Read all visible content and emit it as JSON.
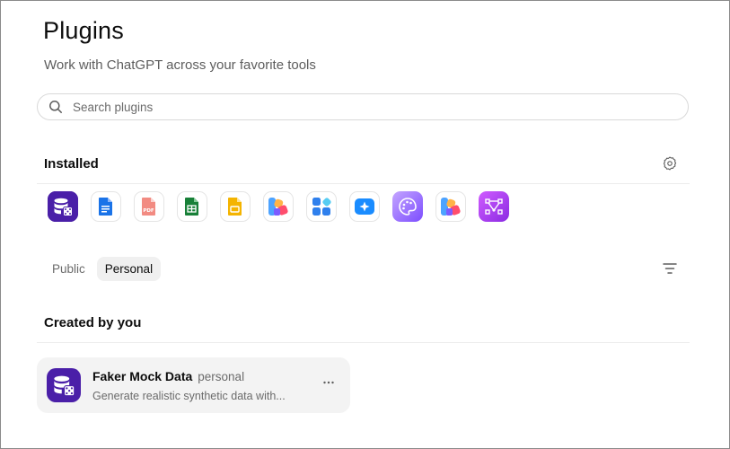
{
  "header": {
    "title": "Plugins",
    "subtitle": "Work with ChatGPT across your favorite tools"
  },
  "search": {
    "placeholder": "Search plugins",
    "value": ""
  },
  "installed": {
    "heading": "Installed",
    "plugins": [
      {
        "icon": "database-dice-icon",
        "color": "#5b21b6"
      },
      {
        "icon": "document-icon",
        "color": "#1a73e8"
      },
      {
        "icon": "pdf-icon",
        "color": "#ea4335"
      },
      {
        "icon": "spreadsheet-icon",
        "color": "#188038"
      },
      {
        "icon": "presentation-icon",
        "color": "#f9ab00"
      },
      {
        "icon": "colorful-logo-icon",
        "color": "#ff6f61"
      },
      {
        "icon": "apps-grid-icon",
        "color": "#2f80ed"
      },
      {
        "icon": "sparkle-icon",
        "color": "#1a8cff"
      },
      {
        "icon": "palette-icon",
        "color": "#8b5cf6"
      },
      {
        "icon": "colorful-logo-icon",
        "color": "#ff6f61"
      },
      {
        "icon": "vector-nodes-icon",
        "color": "#a23ff0"
      }
    ]
  },
  "tabs": [
    {
      "label": "Public",
      "active": false
    },
    {
      "label": "Personal",
      "active": true
    }
  ],
  "created": {
    "heading": "Created by you",
    "items": [
      {
        "name": "Faker Mock Data",
        "tag": "personal",
        "description": "Generate realistic synthetic data with..."
      }
    ]
  }
}
